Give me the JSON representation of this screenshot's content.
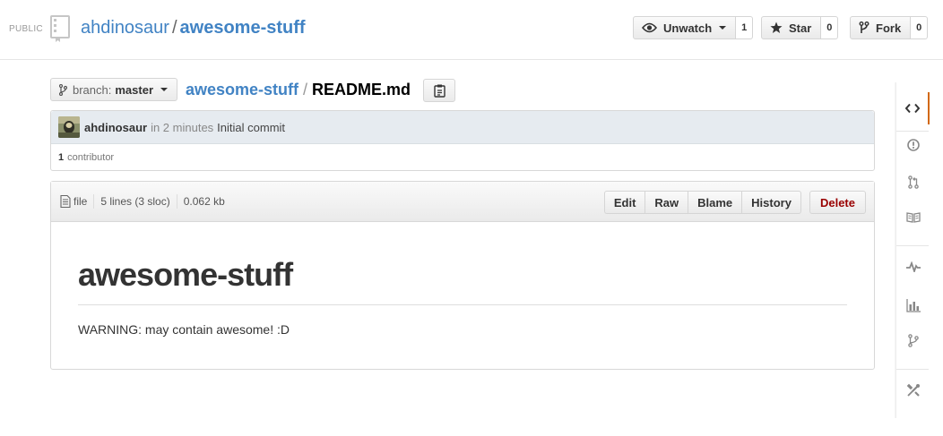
{
  "header": {
    "visibility": "PUBLIC",
    "owner": "ahdinosaur",
    "separator": "/",
    "repo": "awesome-stuff",
    "watch": {
      "label": "Unwatch",
      "count": "1"
    },
    "star": {
      "label": "Star",
      "count": "0"
    },
    "fork": {
      "label": "Fork",
      "count": "0"
    }
  },
  "branch": {
    "prefix": "branch:",
    "name": "master"
  },
  "breadcrumb": {
    "repo": "awesome-stuff",
    "separator": "/",
    "file": "README.md"
  },
  "commit": {
    "author": "ahdinosaur",
    "time": "in 2 minutes",
    "message": "Initial commit",
    "contributors_count": "1",
    "contributors_label": "contributor"
  },
  "file": {
    "type_label": "file",
    "lines": "5 lines (3 sloc)",
    "size": "0.062 kb",
    "actions": {
      "edit": "Edit",
      "raw": "Raw",
      "blame": "Blame",
      "history": "History",
      "delete": "Delete"
    }
  },
  "readme": {
    "heading": "awesome-stuff",
    "body": "WARNING: may contain awesome! :D"
  },
  "repo_nav": {
    "items": [
      "code-icon",
      "issues-icon",
      "pull-requests-icon",
      "wiki-icon",
      "pulse-icon",
      "graphs-icon",
      "network-icon",
      "settings-icon"
    ],
    "selected": "code-icon",
    "accent_color": "#d26911"
  },
  "colors": {
    "link": "#4183c4",
    "danger": "#990000",
    "commit_bg": "#e6ebf0"
  }
}
